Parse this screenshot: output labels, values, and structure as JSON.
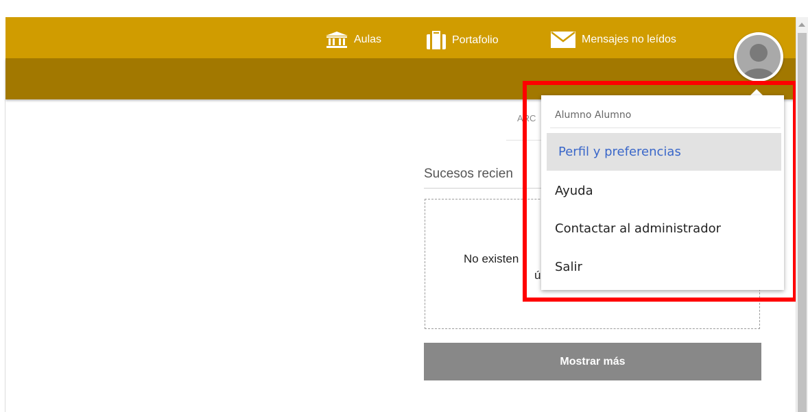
{
  "nav": {
    "aulas": "Aulas",
    "portafolio": "Portafolio",
    "mensajes": "Mensajes no leídos"
  },
  "main": {
    "category_partial": "ARC",
    "section_title": "Sucesos recien",
    "empty_line1": "No existen",
    "empty_line2": "ú",
    "more_button": "Mostrar más"
  },
  "dropdown": {
    "user_name": "Alumno Alumno",
    "items": [
      {
        "label": "Perfil y preferencias",
        "active": true
      },
      {
        "label": "Ayuda"
      },
      {
        "label": "Contactar al administrador"
      },
      {
        "label": "Salir"
      }
    ]
  },
  "colors": {
    "topbar": "#d09c00",
    "subbar": "#a27800",
    "highlight": "#ff0000",
    "active_link": "#3a67c9",
    "button": "#888888"
  },
  "icons": [
    "institution-icon",
    "briefcase-icon",
    "envelope-icon",
    "user-avatar-icon"
  ]
}
